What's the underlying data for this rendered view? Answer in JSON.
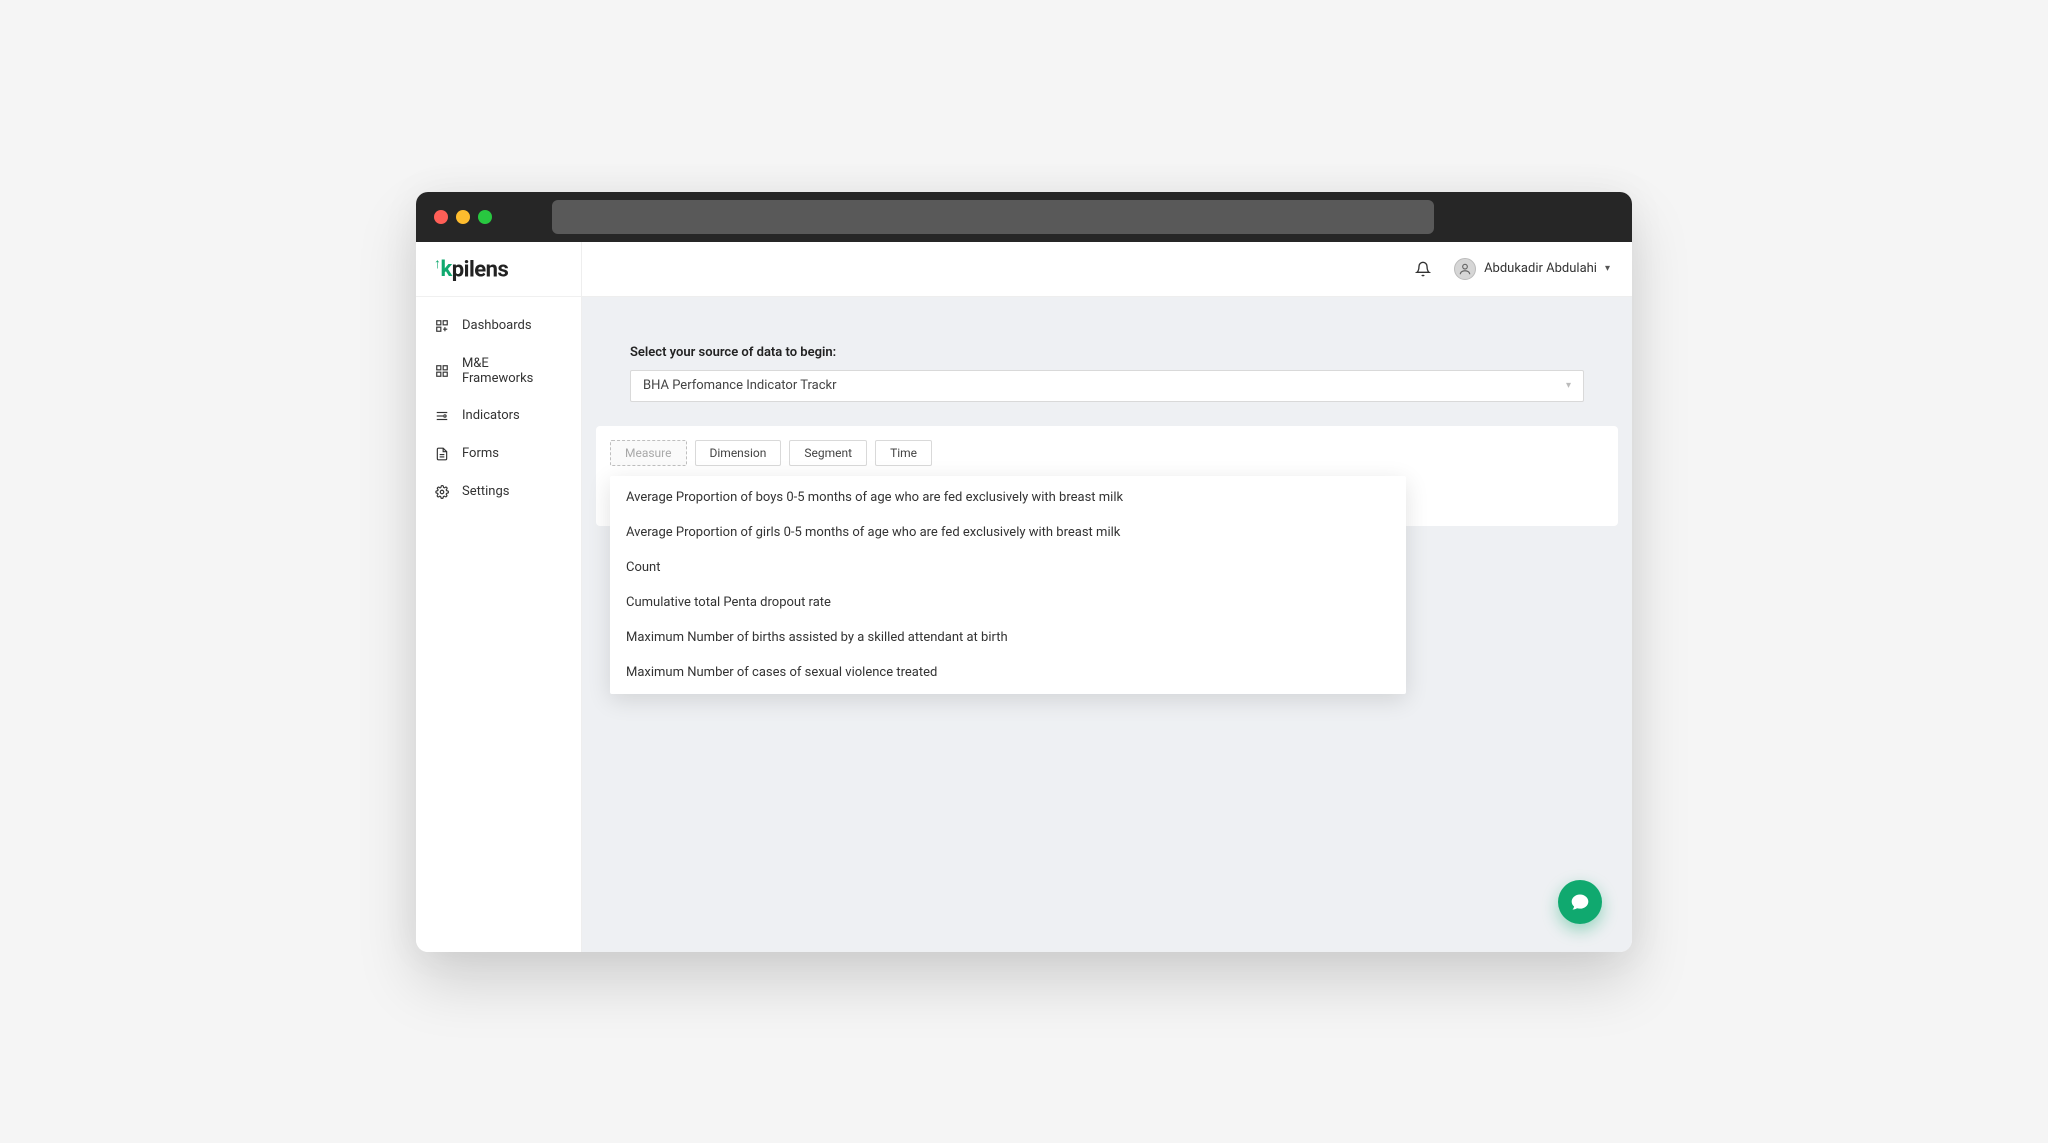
{
  "brand": {
    "prefix": "k",
    "rest": "pilens"
  },
  "sidebar": {
    "items": [
      {
        "label": "Dashboards"
      },
      {
        "label": "M&E Frameworks"
      },
      {
        "label": "Indicators"
      },
      {
        "label": "Forms"
      },
      {
        "label": "Settings"
      }
    ]
  },
  "topbar": {
    "user_name": "Abdukadir Abdulahi"
  },
  "source": {
    "label": "Select your source of data to begin:",
    "selected": "BHA Perfomance Indicator Trackr"
  },
  "tabs": {
    "measure": "Measure",
    "dimension": "Dimension",
    "segment": "Segment",
    "time": "Time"
  },
  "dropdown": {
    "items": [
      "Average Proportion of boys 0-5 months of age who are fed exclusively with breast milk",
      "Average Proportion of girls 0-5 months of age who are fed exclusively with breast milk",
      "Count",
      "Cumulative total Penta dropout rate",
      "Maximum Number of births assisted by a skilled attendant at birth",
      "Maximum Number of cases of sexual violence treated"
    ]
  }
}
